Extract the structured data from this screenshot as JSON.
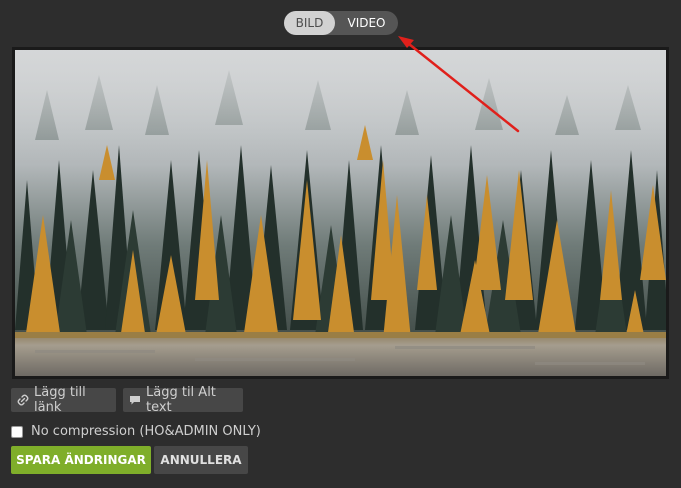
{
  "media_toggle": {
    "options": [
      "BILD",
      "VIDEO"
    ],
    "selected": "BILD"
  },
  "preview": {
    "image": "forest-landscape"
  },
  "actions": {
    "link_label": "Lägg till länk",
    "alt_label": "Lägg til Alt text"
  },
  "compression": {
    "label": "No compression (HO&ADMIN ONLY)",
    "checked": false
  },
  "footer": {
    "save_label": "SPARA ÄNDRINGAR",
    "cancel_label": "ANNULLERA"
  },
  "colors": {
    "background": "#2d2d2d",
    "save": "#7fae2a",
    "annotation_arrow": "#e0201b"
  }
}
